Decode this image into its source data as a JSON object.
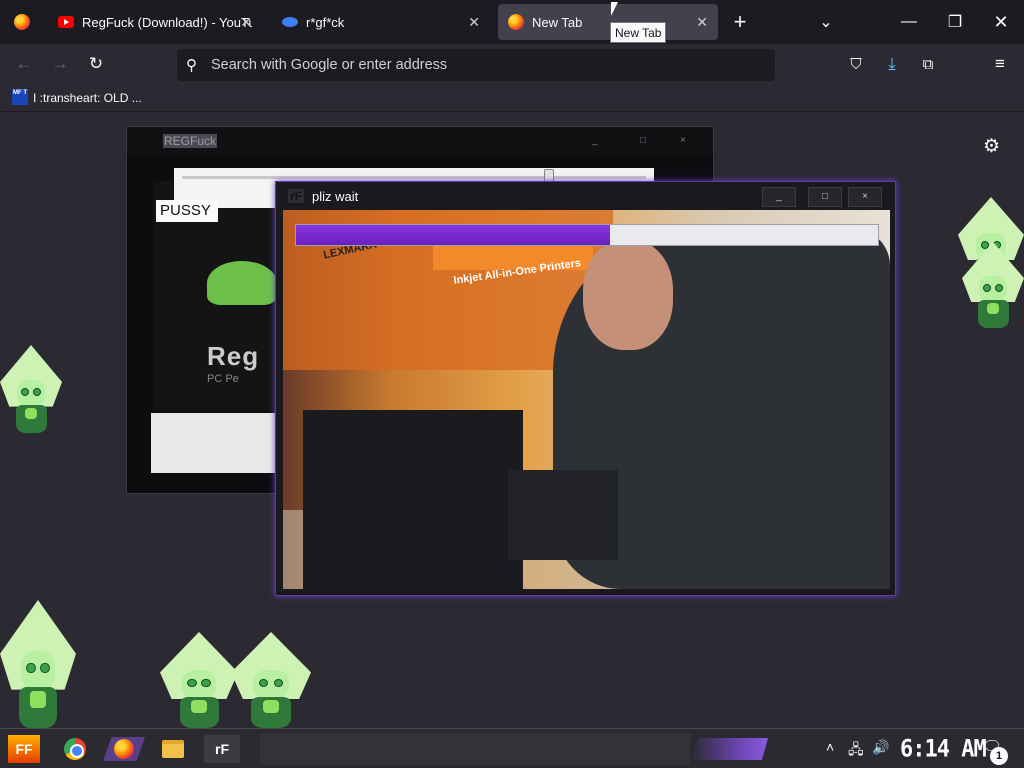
{
  "browser": {
    "tabs": [
      {
        "title": "",
        "icon": "firefox-icon"
      },
      {
        "title": "RegFuck (Download!) - YouTube",
        "icon": "youtube-icon"
      },
      {
        "title": "r*gf*ck",
        "icon": "eye-icon"
      },
      {
        "title": "New Tab",
        "icon": "firefox-icon",
        "active": true
      }
    ],
    "tooltip": "New Tab",
    "url_placeholder": "Search with Google or enter address",
    "bookmarks": [
      {
        "label": "I :transheart: OLD ...",
        "favicon_text": "MF T"
      }
    ]
  },
  "regfuck_window": {
    "title": "REGFuck",
    "pussy_label": "PUSSY",
    "logo_text": "Reg",
    "logo_sub": "PC Pe",
    "slider_value_fraction": 0.79
  },
  "wait_window": {
    "icon_text": "rF",
    "title": "pliz wait",
    "progress_fraction": 0.54,
    "min": "_",
    "max": "□",
    "close": "×",
    "video_sign": "Inkjet All-in-One Printers",
    "video_brand": "LEXMARK"
  },
  "taskbar": {
    "start_label": "FF",
    "rf_label": "rF",
    "time": "6:14 AM",
    "notification_count": "1"
  },
  "colors": {
    "accent_purple": "#7a2fd6",
    "browser_bg": "#2b2a33",
    "tabstrip_bg": "#1c1b22"
  }
}
